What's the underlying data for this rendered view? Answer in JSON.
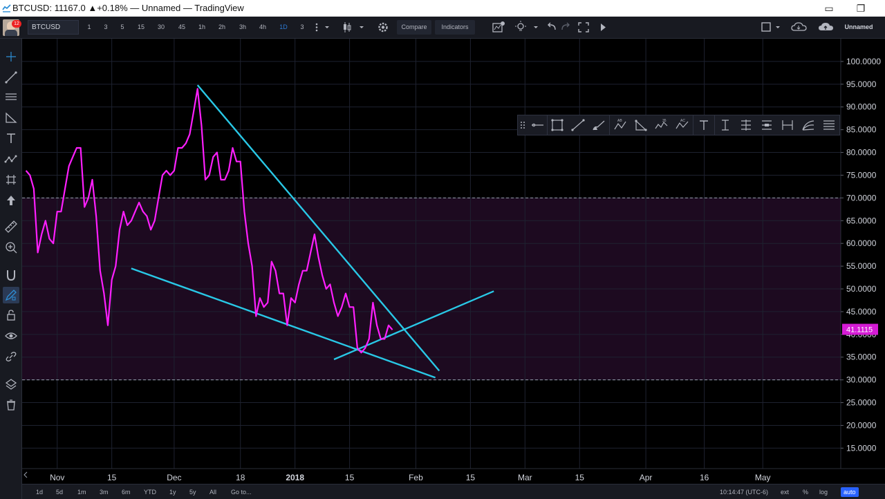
{
  "window": {
    "title": "BTCUSD: 11167.0 ▲+0.18% — Unnamed — TradingView",
    "restore_glyph": "▭",
    "maximize_glyph": "❐"
  },
  "toolbar": {
    "avatar_badge": "12",
    "symbol": "BTCUSD",
    "intervals": [
      "1",
      "3",
      "5",
      "15",
      "30",
      "45",
      "1h",
      "2h",
      "3h",
      "4h",
      "1D",
      "3"
    ],
    "selected_interval": "1D",
    "compare_label": "Compare",
    "indicators_label": "Indicators",
    "layout_name": "Unnamed"
  },
  "bottombar": {
    "ranges": [
      "1d",
      "5d",
      "1m",
      "3m",
      "6m",
      "YTD",
      "1y",
      "5y",
      "All"
    ],
    "goto_label": "Go to...",
    "time": "10:14:47 (UTC-6)",
    "ext_label": "ext",
    "percent_label": "%",
    "log_label": "log",
    "auto_label": "auto"
  },
  "icons": {
    "left_toolbar": [
      "crosshair-icon",
      "trend-line-icon",
      "parallel-channel-icon",
      "pitchfork-icon",
      "text-icon",
      "pattern-icon",
      "prediction-icon",
      "arrow-up-icon",
      "ruler-icon",
      "zoom-in-icon",
      "magnet-icon",
      "drawing-mode-icon",
      "lock-icon",
      "eye-icon",
      "link-icon",
      "layers-icon",
      "trash-icon"
    ],
    "drawing_toolbar": [
      "horizontal-ray-icon",
      "rectangle-icon",
      "line-icon",
      "brush-icon",
      "abcd-pattern-icon",
      "triangle-icon",
      "elliott-wave-icon",
      "abc-wave-icon",
      "text-icon",
      "price-range-icon",
      "date-range-icon",
      "date-price-range-icon",
      "measure-icon",
      "fib-fan-icon",
      "fib-retracement-icon"
    ]
  },
  "colors": {
    "price_line": "#ff1fff",
    "trendlines": "#29c8e6",
    "zone_fill": "#1d0a20",
    "grid": "#1e2230",
    "price_tag_bg": "#d51bd5",
    "background": "#000000"
  },
  "chart_data": {
    "type": "line",
    "series": [
      {
        "x": [
          "2017-10-24",
          "2017-10-25",
          "2017-10-26",
          "2017-10-27",
          "2017-10-28",
          "2017-10-29",
          "2017-10-30",
          "2017-10-31",
          "2017-11-01",
          "2017-11-02",
          "2017-11-03",
          "2017-11-04",
          "2017-11-05",
          "2017-11-06",
          "2017-11-07",
          "2017-11-08",
          "2017-11-09",
          "2017-11-10",
          "2017-11-11",
          "2017-11-12",
          "2017-11-13",
          "2017-11-14",
          "2017-11-15",
          "2017-11-16",
          "2017-11-17",
          "2017-11-18",
          "2017-11-19",
          "2017-11-20",
          "2017-11-21",
          "2017-11-22",
          "2017-11-23",
          "2017-11-24",
          "2017-11-25",
          "2017-11-26",
          "2017-11-27",
          "2017-11-28",
          "2017-11-29",
          "2017-11-30",
          "2017-12-01",
          "2017-12-02",
          "2017-12-03",
          "2017-12-04",
          "2017-12-05",
          "2017-12-06",
          "2017-12-07",
          "2017-12-08",
          "2017-12-09",
          "2017-12-10",
          "2017-12-11",
          "2017-12-12",
          "2017-12-13",
          "2017-12-14",
          "2017-12-15",
          "2017-12-16",
          "2017-12-17",
          "2017-12-18",
          "2017-12-19",
          "2017-12-20",
          "2017-12-21",
          "2017-12-22",
          "2017-12-23",
          "2017-12-24",
          "2017-12-25",
          "2017-12-26",
          "2017-12-27",
          "2017-12-28",
          "2017-12-29",
          "2017-12-30",
          "2017-12-31",
          "2018-01-01",
          "2018-01-02",
          "2018-01-03",
          "2018-01-04",
          "2018-01-05",
          "2018-01-06",
          "2018-01-07",
          "2018-01-08",
          "2018-01-09",
          "2018-01-10",
          "2018-01-11",
          "2018-01-12",
          "2018-01-13",
          "2018-01-14",
          "2018-01-15",
          "2018-01-16",
          "2018-01-17",
          "2018-01-18",
          "2018-01-19",
          "2018-01-20",
          "2018-01-21",
          "2018-01-22",
          "2018-01-23",
          "2018-01-24",
          "2018-01-25",
          "2018-01-26"
        ],
        "y": [
          76,
          75,
          72,
          58,
          62,
          65,
          61,
          60,
          67,
          67,
          72,
          77,
          79,
          81,
          81,
          68,
          70,
          74,
          66,
          54,
          49,
          42,
          52,
          55,
          63,
          67,
          64,
          65,
          67,
          69,
          67,
          66,
          63,
          65,
          70,
          75,
          76,
          75,
          76,
          81,
          81,
          82,
          84,
          89,
          94,
          86,
          74,
          75,
          79,
          80,
          74,
          74,
          76,
          81,
          78,
          78,
          67,
          60,
          55,
          44,
          48,
          46,
          47,
          56,
          54,
          49,
          49,
          42,
          48,
          47,
          51,
          54,
          54,
          58,
          62,
          57,
          53,
          50,
          51,
          47,
          44,
          46,
          49,
          46,
          46,
          37,
          36,
          37,
          39,
          47,
          42,
          39,
          39,
          42,
          41
        ]
      }
    ],
    "x_tick_labels": [
      "Nov",
      "15",
      "Dec",
      "18",
      "2018",
      "15",
      "Feb",
      "15",
      "Mar",
      "15",
      "Apr",
      "16",
      "May"
    ],
    "y_ticks": [
      15,
      20,
      25,
      30,
      35,
      40,
      45,
      50,
      55,
      60,
      65,
      70,
      75,
      80,
      85,
      90,
      95,
      100
    ],
    "y_tick_labels": [
      "15.0000",
      "20.0000",
      "25.0000",
      "30.0000",
      "35.0000",
      "40.0000",
      "45.0000",
      "50.0000",
      "55.0000",
      "60.0000",
      "65.0000",
      "70.0000",
      "75.0000",
      "80.0000",
      "85.0000",
      "90.0000",
      "95.0000",
      "100.0000"
    ],
    "ylim": [
      10.5,
      105
    ],
    "xlim": [
      "2017-10-23",
      "2018-05-21"
    ],
    "current_price_label": "41.1115",
    "current_price": 41.1115,
    "zone": [
      30,
      70
    ],
    "trendlines": [
      {
        "x": [
          "2017-12-07",
          "2018-02-07"
        ],
        "y": [
          94.8,
          32
        ]
      },
      {
        "x": [
          "2017-11-20",
          "2018-02-06"
        ],
        "y": [
          54.5,
          30.5
        ]
      },
      {
        "x": [
          "2018-01-11",
          "2018-02-21"
        ],
        "y": [
          34.5,
          49.5
        ]
      }
    ],
    "grid": true
  }
}
